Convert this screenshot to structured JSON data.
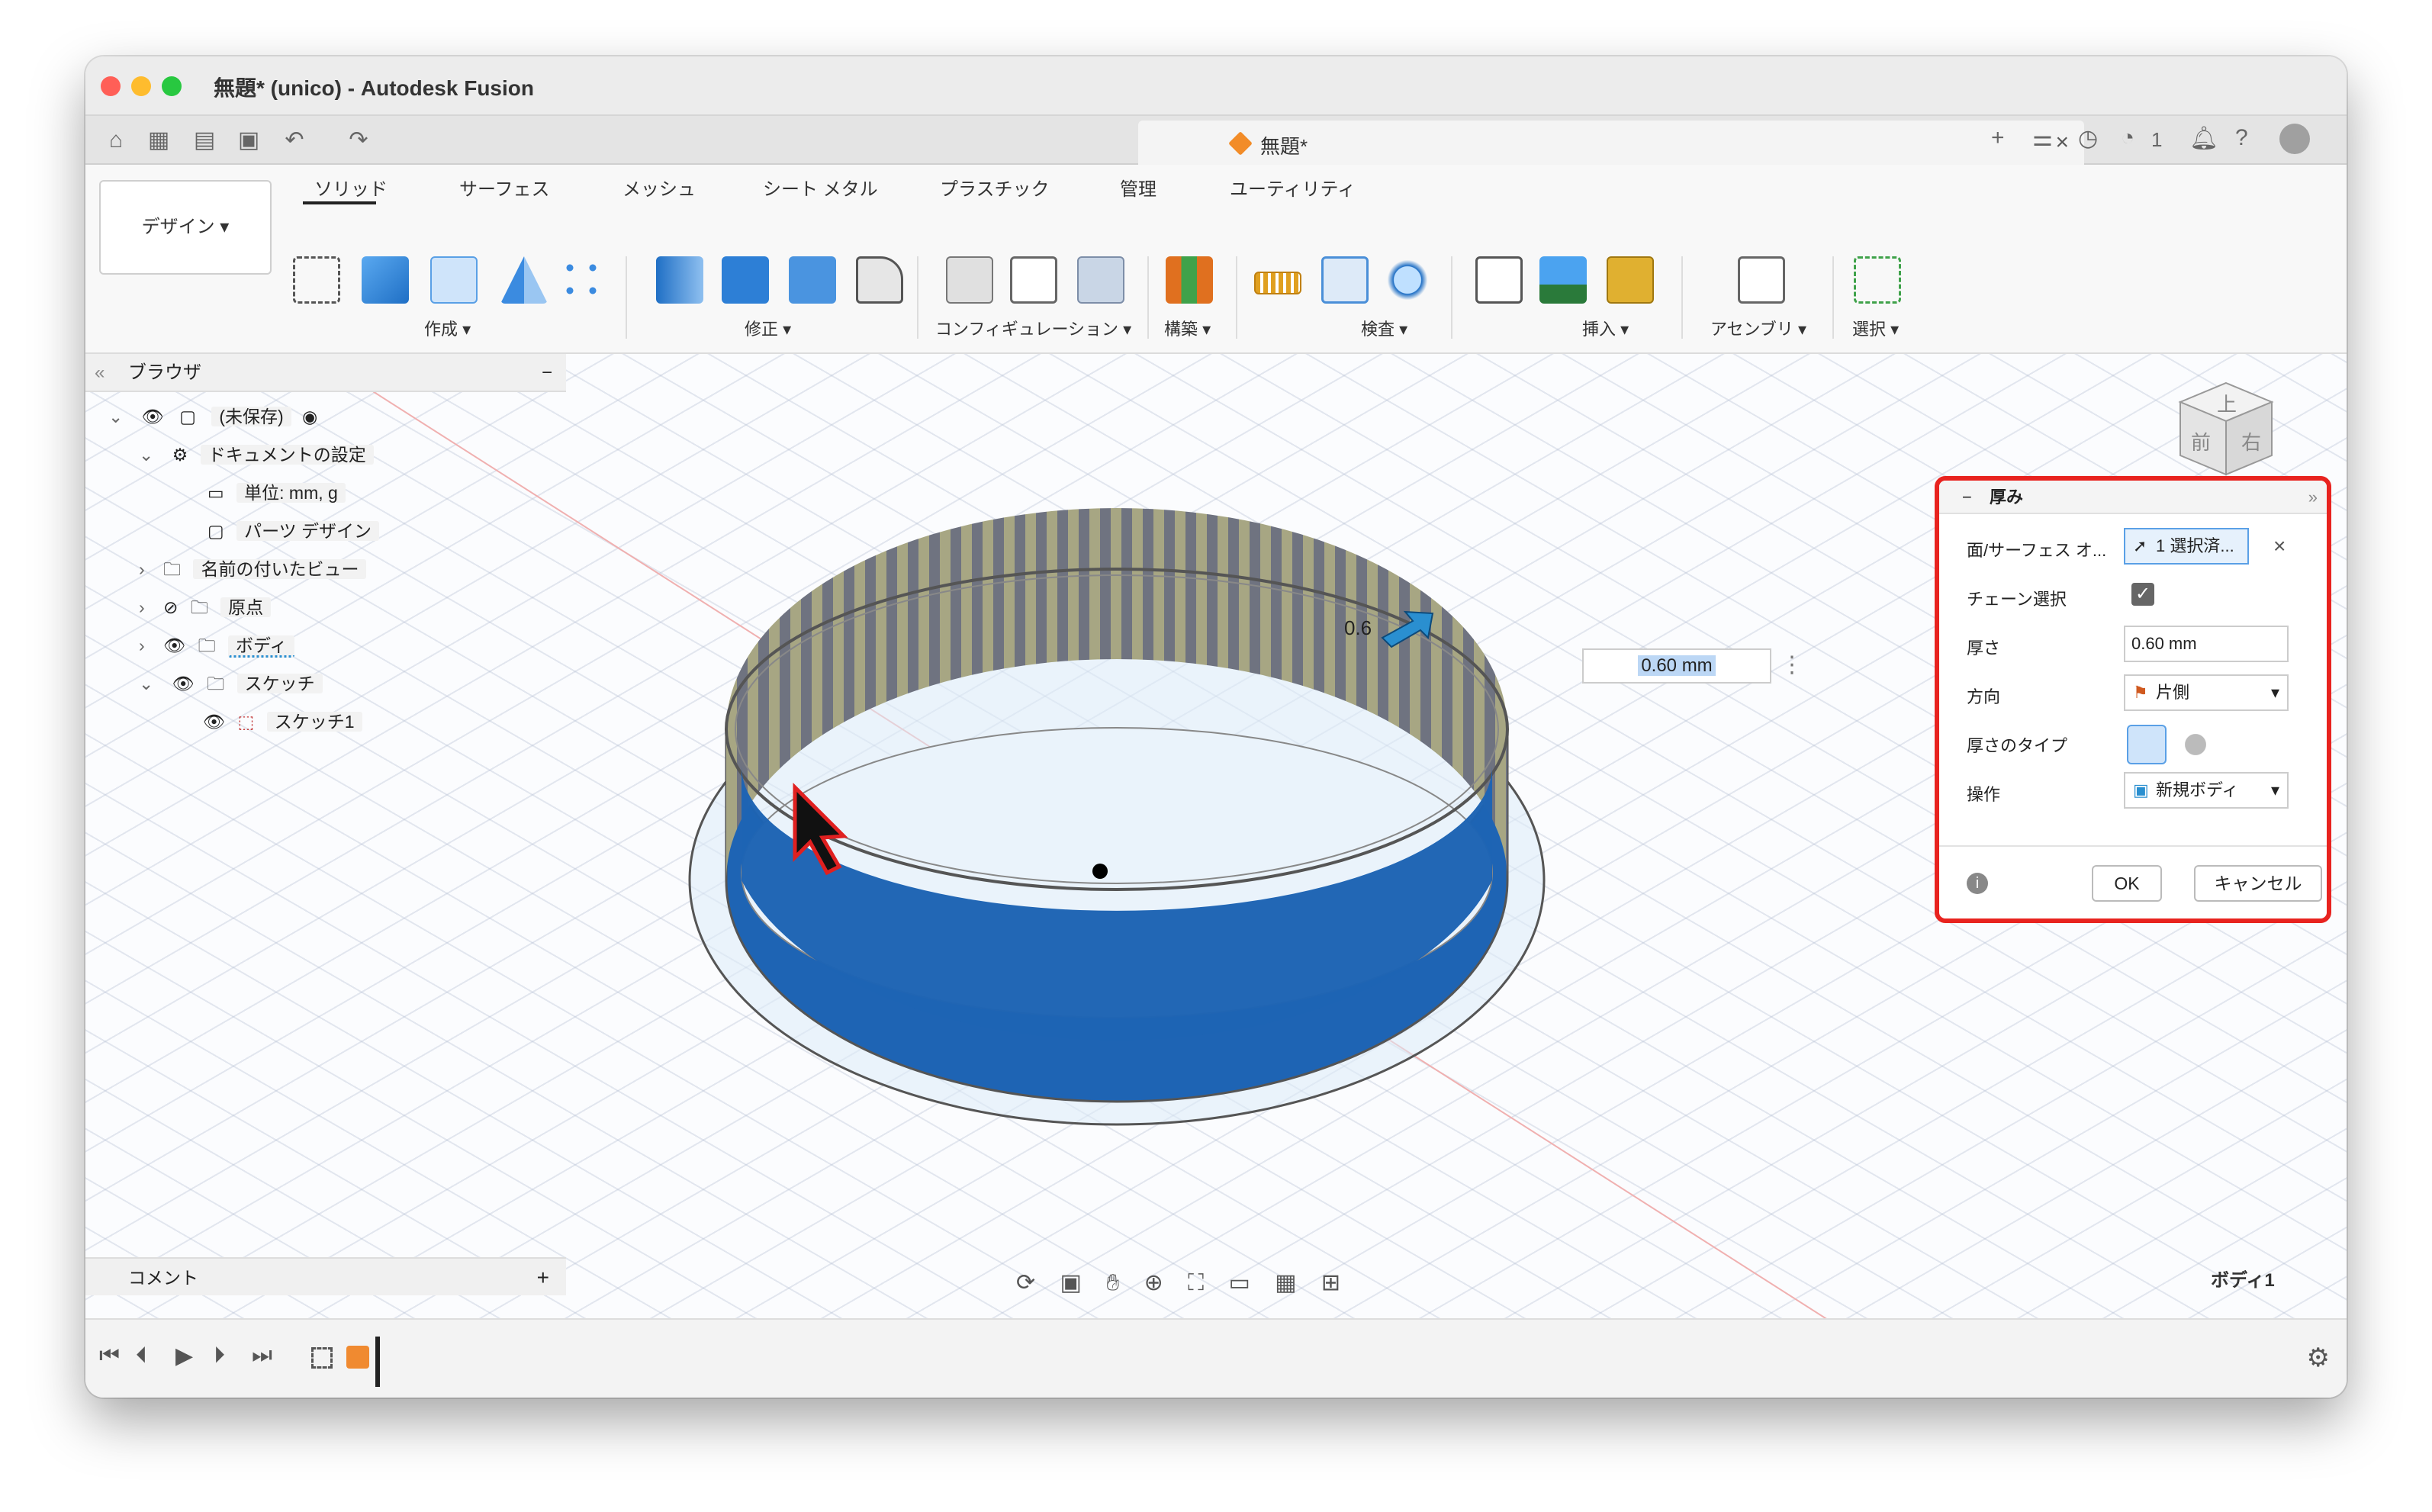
{
  "window": {
    "title": "無題* (unico) - Autodesk Fusion"
  },
  "quickbar": {
    "doc_tab_title": "無題*",
    "jobs_count": "1"
  },
  "toolbar": {
    "workspace": "デザイン",
    "tabs": [
      "ソリッド",
      "サーフェス",
      "メッシュ",
      "シート メタル",
      "プラスチック",
      "管理",
      "ユーティリティ"
    ],
    "groups": [
      "作成",
      "修正",
      "コンフィギュレーション",
      "構築",
      "検査",
      "挿入",
      "アセンブリ",
      "選択"
    ]
  },
  "browser": {
    "title": "ブラウザ",
    "root": "(未保存)",
    "items": [
      {
        "label": "ドキュメントの設定"
      },
      {
        "label": "単位: mm, g"
      },
      {
        "label": "パーツ デザイン"
      },
      {
        "label": "名前の付いたビュー"
      },
      {
        "label": "原点"
      },
      {
        "label": "ボディ"
      },
      {
        "label": "スケッチ"
      },
      {
        "label": "スケッチ1"
      }
    ]
  },
  "comments": {
    "label": "コメント"
  },
  "viewport": {
    "floating_value": "0.60 mm",
    "dim_label": "0.6",
    "body_name": "ボディ1",
    "viewcube": {
      "top": "上",
      "front": "前",
      "right": "右"
    }
  },
  "thicken_panel": {
    "title": "厚み",
    "face_label": "面/サーフェス オ...",
    "face_value": "1 選択済...",
    "chain_label": "チェーン選択",
    "chain_checked": true,
    "thickness_label": "厚さ",
    "thickness_value": "0.60 mm",
    "direction_label": "方向",
    "direction_value": "片側",
    "type_label": "厚さのタイプ",
    "operation_label": "操作",
    "operation_value": "新規ボディ",
    "ok_label": "OK",
    "cancel_label": "キャンセル"
  },
  "colors": {
    "accent": "#1f6fc5",
    "panel_border": "#e8231f",
    "body_blue": "#1e64b4"
  }
}
